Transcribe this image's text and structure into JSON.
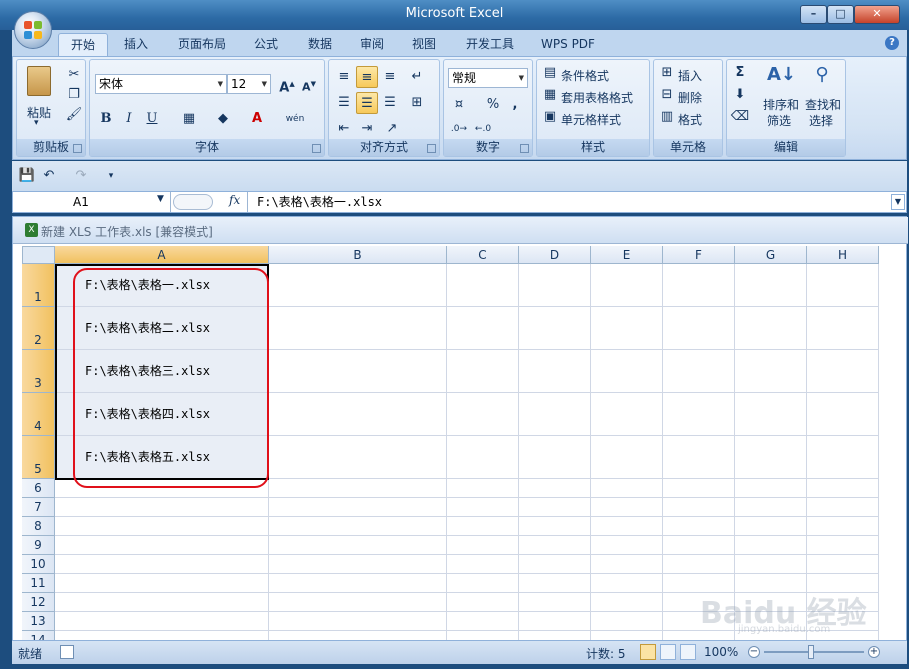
{
  "app": {
    "title": "Microsoft Excel"
  },
  "ribbon": {
    "tabs": [
      "开始",
      "插入",
      "页面布局",
      "公式",
      "数据",
      "审阅",
      "视图",
      "开发工具",
      "WPS PDF"
    ],
    "active_tab": "开始",
    "clipboard": {
      "paste": "粘贴",
      "group": "剪贴板"
    },
    "font": {
      "name": "宋体",
      "size": "12",
      "bold": "B",
      "italic": "I",
      "underline": "U",
      "phonetic": "wén",
      "group": "字体"
    },
    "alignment": {
      "group": "对齐方式"
    },
    "number": {
      "format": "常规",
      "percent": "%",
      "comma": ",",
      "group": "数字"
    },
    "styles": {
      "conditional": "条件格式",
      "table": "套用表格格式",
      "cell": "单元格样式",
      "group": "样式"
    },
    "cells": {
      "insert": "插入",
      "delete": "删除",
      "format": "格式",
      "group": "单元格"
    },
    "editing": {
      "sort_l1": "排序和",
      "sort_l2": "筛选",
      "find_l1": "查找和",
      "find_l2": "选择",
      "group": "编辑"
    }
  },
  "formula_bar": {
    "name_box": "A1",
    "fx": "fx",
    "formula": "F:\\表格\\表格一.xlsx"
  },
  "workbook": {
    "title": "新建 XLS 工作表.xls  [兼容模式]"
  },
  "sheet": {
    "columns": [
      "A",
      "B",
      "C",
      "D",
      "E",
      "F",
      "G",
      "H"
    ],
    "selected_column": "A",
    "rows": [
      "1",
      "2",
      "3",
      "4",
      "5",
      "6",
      "7",
      "8",
      "9",
      "10",
      "11",
      "12",
      "13",
      "14"
    ],
    "cells_a": [
      "F:\\表格\\表格一.xlsx",
      "F:\\表格\\表格二.xlsx",
      "F:\\表格\\表格三.xlsx",
      "F:\\表格\\表格四.xlsx",
      "F:\\表格\\表格五.xlsx"
    ]
  },
  "status": {
    "ready": "就绪",
    "count": "计数: 5",
    "zoom": "100%"
  },
  "watermark": {
    "text": "Baidu 经验",
    "url": "jingyan.baidu.com"
  },
  "colors": {
    "accent": "#f1c15f",
    "highlight_ring": "#e0101a"
  }
}
